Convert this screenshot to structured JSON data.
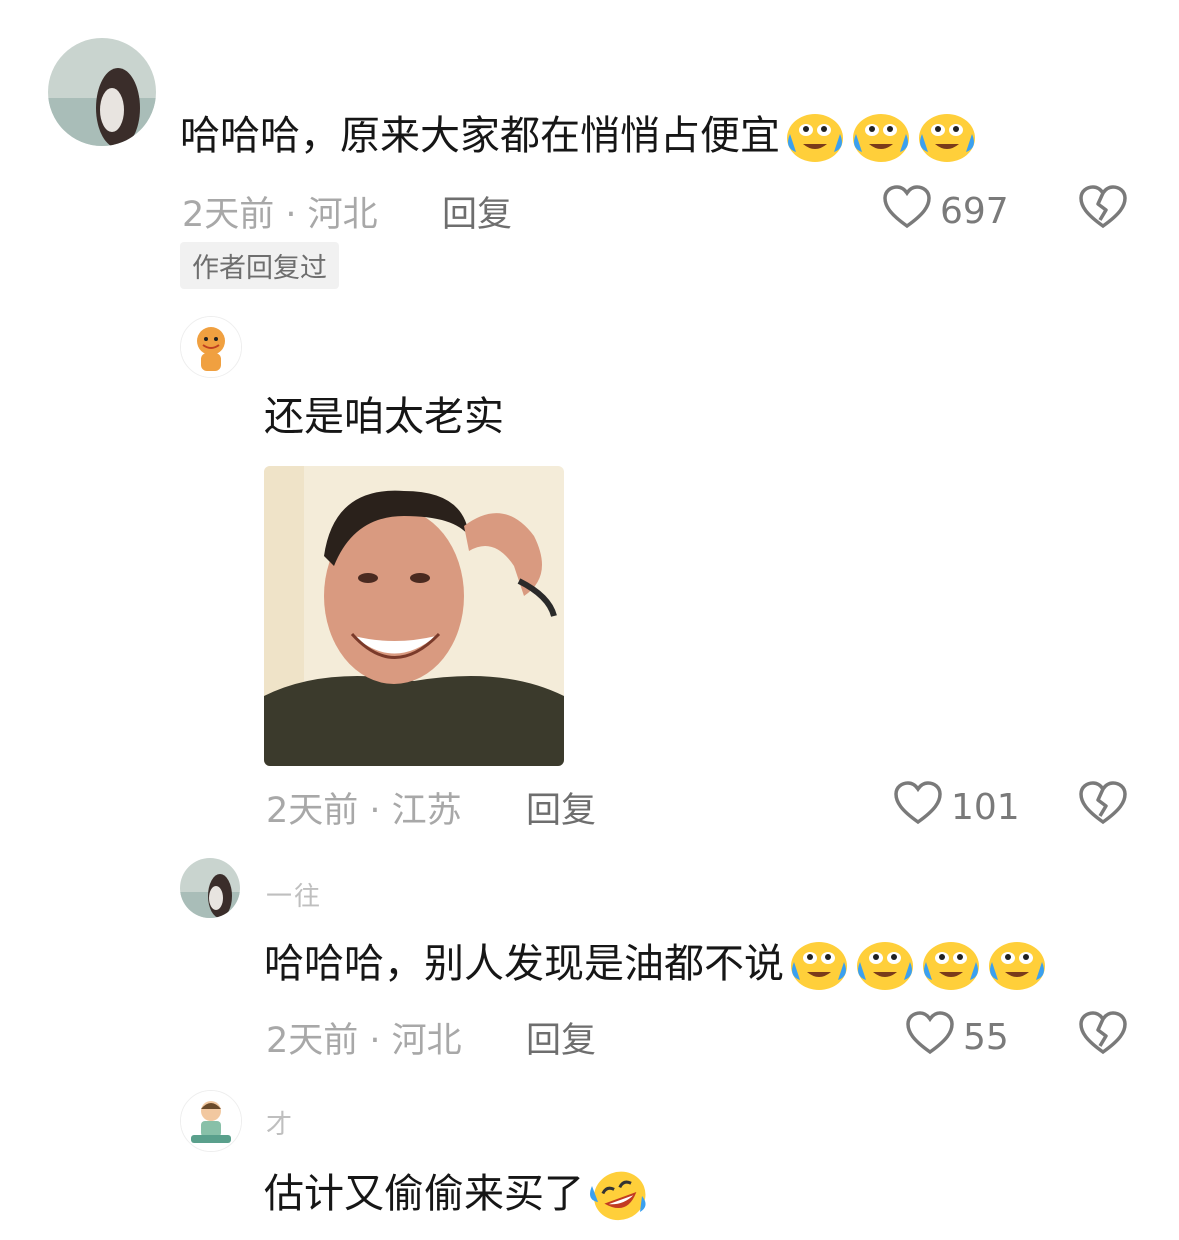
{
  "comments": [
    {
      "text": "哈哈哈，原来大家都在悄悄占便宜",
      "emojis": [
        "crying-laughing",
        "crying-laughing",
        "crying-laughing"
      ],
      "time_location": "2天前 · 河北",
      "reply_label": "回复",
      "likes": "697",
      "author_badge": "作者回复过"
    },
    {
      "text": "还是咱太老实",
      "sticker": "laughing-man-sticker",
      "time_location": "2天前 · 江苏",
      "reply_label": "回复",
      "likes": "101"
    },
    {
      "username_partial": "一往",
      "text": "哈哈哈，别人发现是油都不说",
      "emojis": [
        "crying-laughing",
        "crying-laughing",
        "crying-laughing",
        "crying-laughing"
      ],
      "time_location": "2天前 · 河北",
      "reply_label": "回复",
      "likes": "55"
    },
    {
      "username_partial": "才",
      "text": "估计又偷偷来买了",
      "emojis": [
        "tears-of-joy-tilted"
      ]
    }
  ],
  "colors": {
    "meta": "#a8a8a8",
    "text": "#161616",
    "emoji_face": "#ffcf3a",
    "emoji_tear": "#3aa0f0"
  }
}
